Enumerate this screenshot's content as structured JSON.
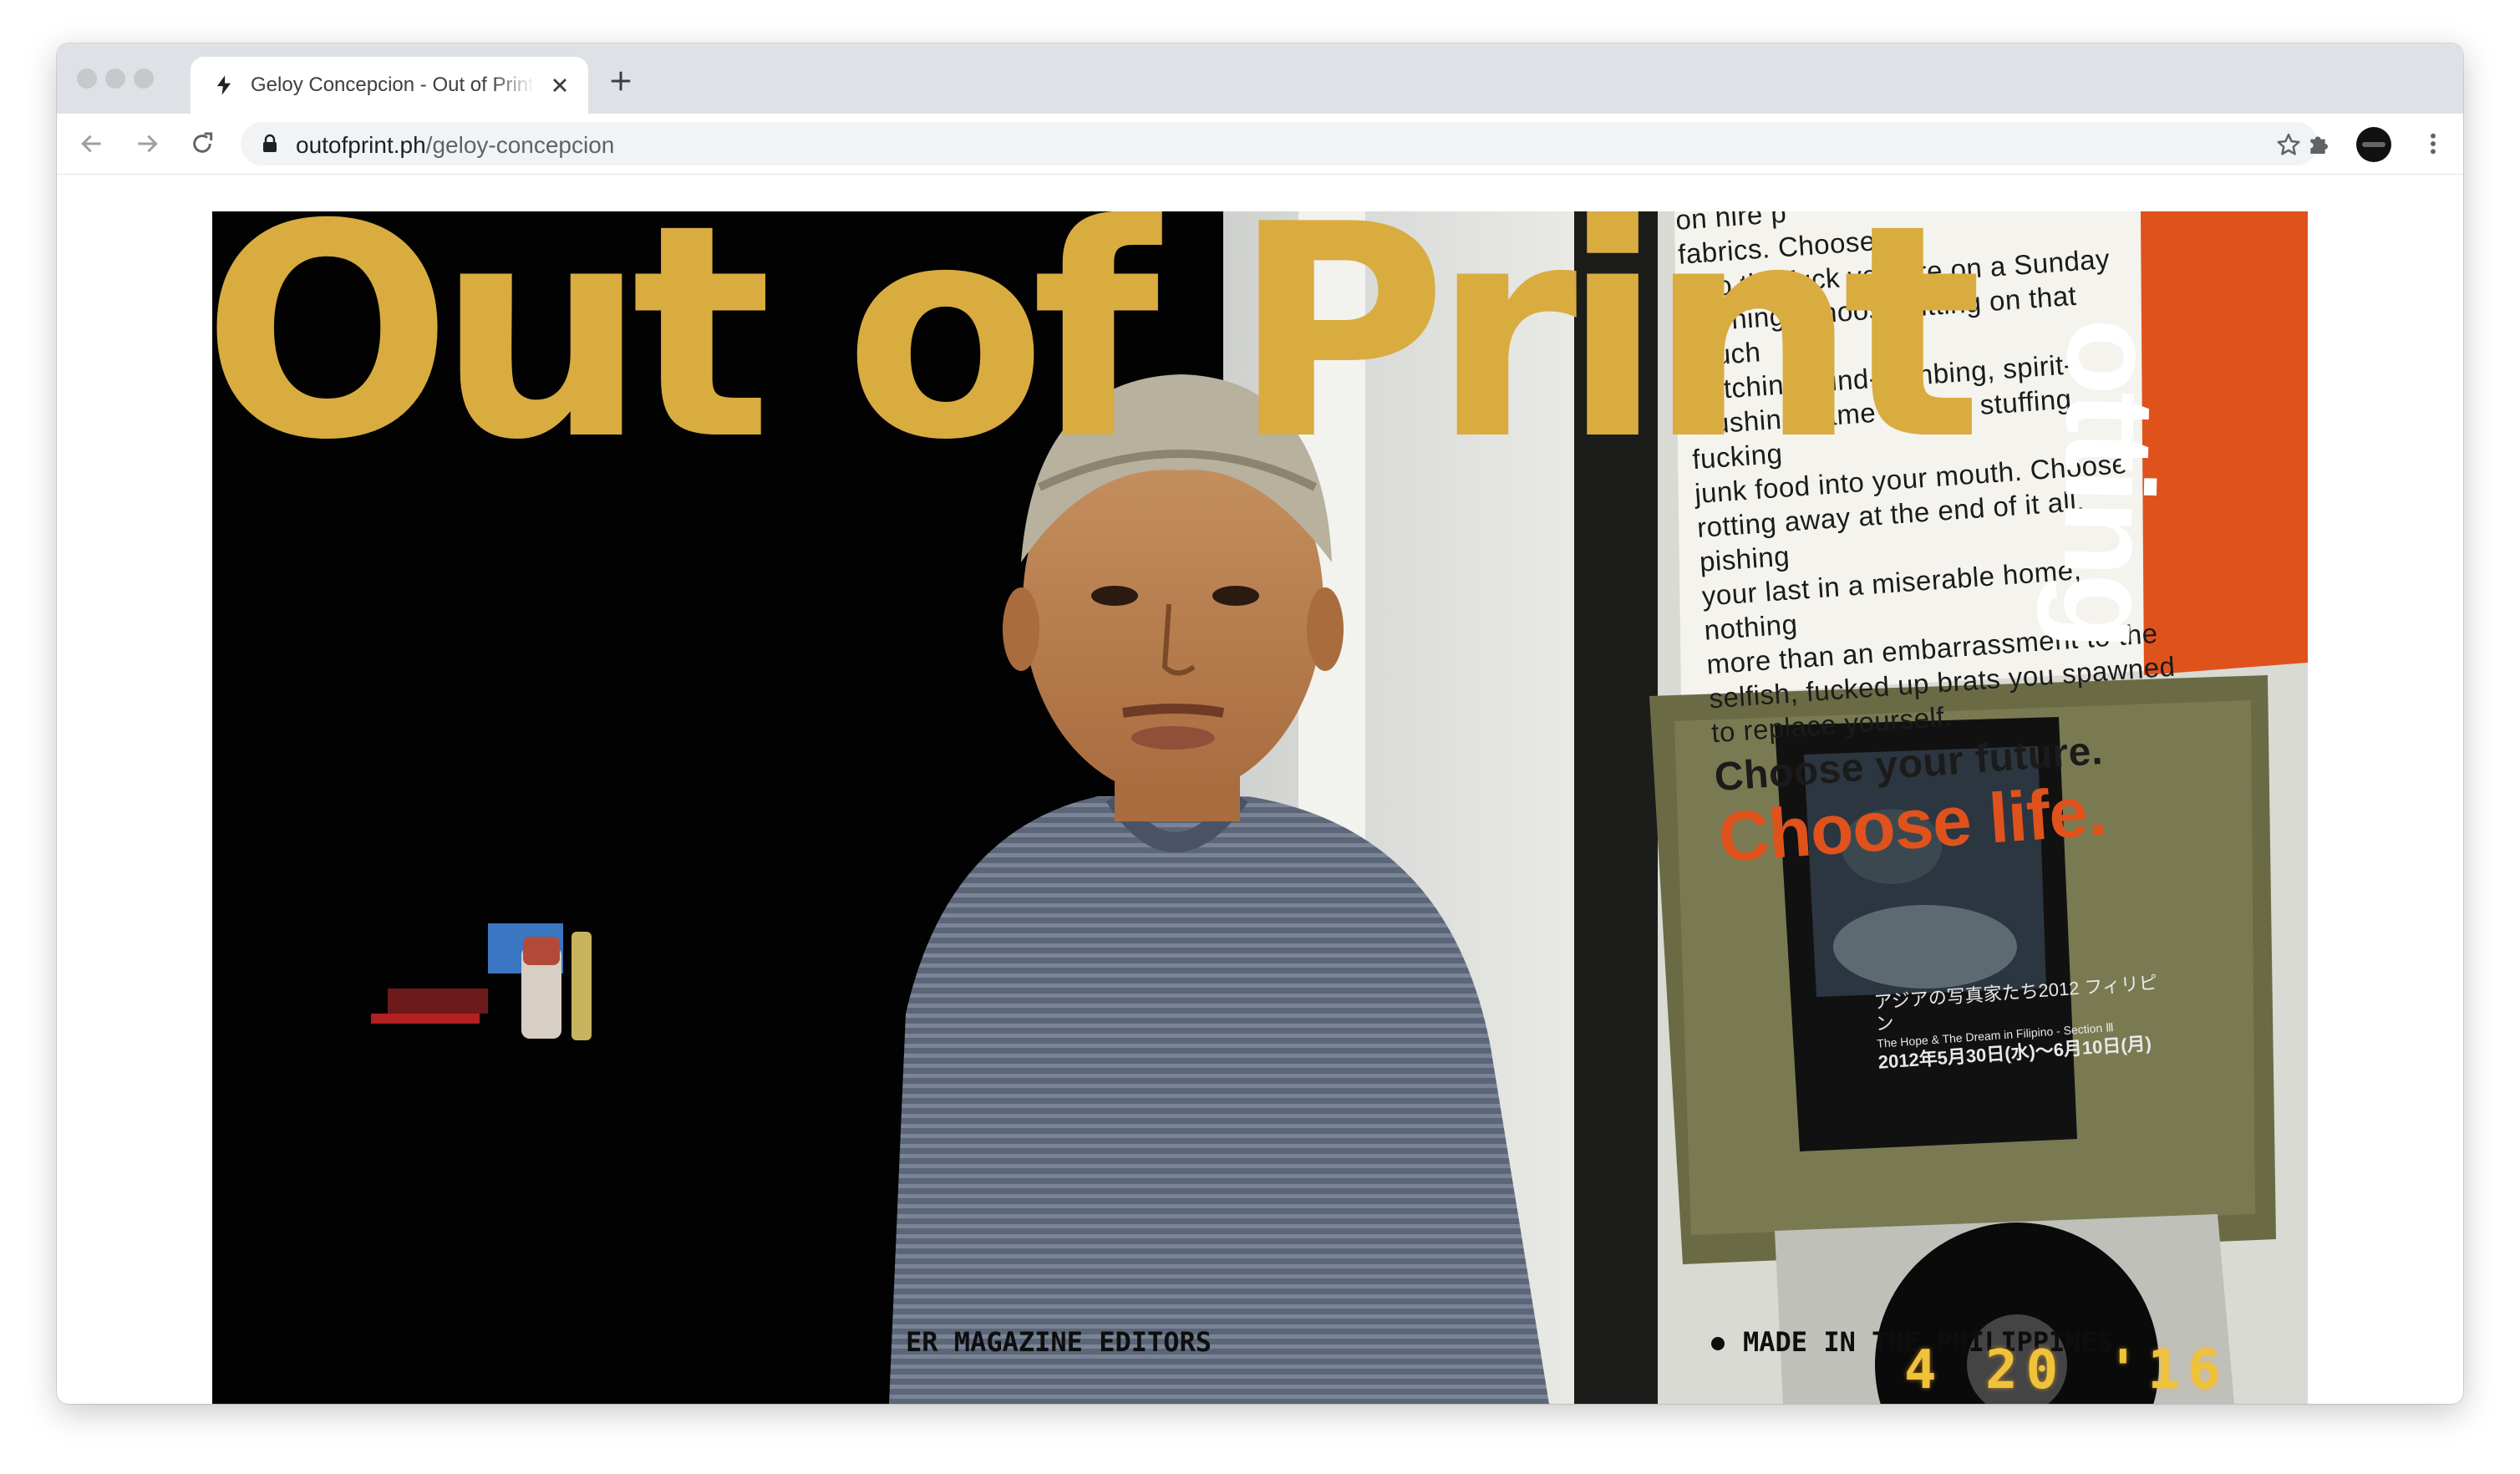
{
  "browser": {
    "tab": {
      "title": "Geloy Concepcion - Out of Print",
      "icon": "lightning-bolt-icon"
    },
    "url": {
      "domain": "outofprint.ph",
      "path": "/geloy-concepcion"
    }
  },
  "page": {
    "logo": "Out of Print",
    "hero_photo_text": {
      "poster_lines": [
        "on hire p",
        "fabrics. Choose DI",
        "who the fuck you are on a Sunday",
        "morning. Choose sitting on that couch",
        "watching mind-numbing, spirit-",
        "crushing game shows, stuffing fucking",
        "junk food into your mouth. Choose",
        "rotting away at the end of it all, pishing",
        "your last in a miserable home, nothing",
        "more than an embarrassment to the",
        "selfish, fucked up brats you spawned",
        "to replace yourself."
      ],
      "poster_bold": "Choose your future.",
      "poster_life": "Choose life.",
      "orange_word": "otting",
      "small_poster": {
        "title": "アジアの写真家たち2012 フィリピン",
        "subtitle": "The Hope & The Dream in Filipino - Section Ⅲ",
        "date": "2012年5月30日(水)～6月10日(月)"
      }
    },
    "ticker": {
      "left": "ER MAGAZINE EDITORS",
      "right": "MADE IN THE PHILIPPINES"
    },
    "date_stamp": "4 20 '16"
  },
  "colors": {
    "logo": "#d9ac40",
    "tabstrip": "#dee1e6",
    "omnibox": "#f1f3f4",
    "date_stamp": "#f0c23a",
    "poster_orange": "#e0521c"
  }
}
